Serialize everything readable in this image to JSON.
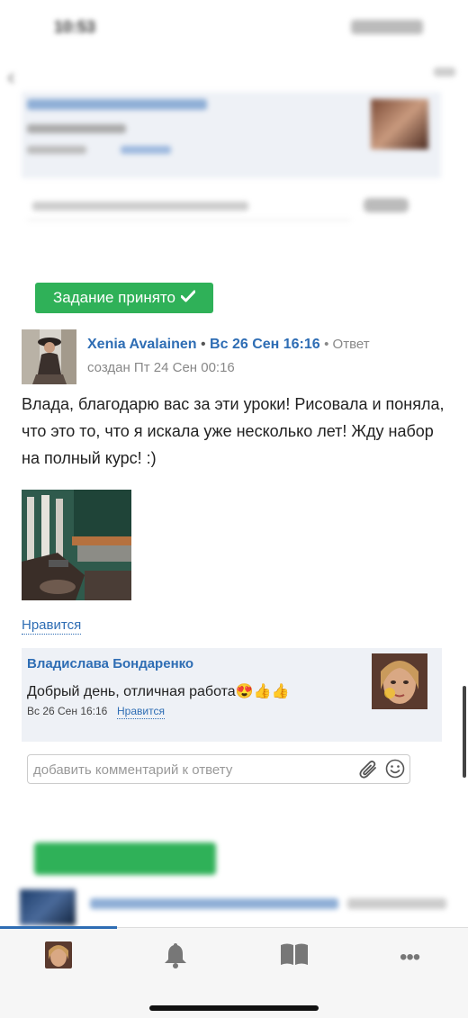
{
  "post": {
    "status_badge": "Задание принято",
    "author": "Xenia Avalainen",
    "bullet": "•",
    "date": "Вс 26 Сен 16:16",
    "meta_suffix": "• Ответ",
    "created_text": "создан Пт 24 Сен 00:16",
    "body": "Влада, благодарю вас за эти уроки! Рисовала и поняла, что это то, что я искала уже несколько лет! Жду набор на полный курс! :)",
    "like_label": "Нравится"
  },
  "comment": {
    "author": "Владислава Бондаренко",
    "text": "Добрый день, отличная работа😍👍👍",
    "date": "Вс 26 Сен 16:16",
    "like_label": "Нравится"
  },
  "comment_input": {
    "placeholder": "добавить комментарий к ответу"
  },
  "tabbar": {
    "items": [
      {
        "icon": "profile-avatar"
      },
      {
        "icon": "bell-icon"
      },
      {
        "icon": "book-icon"
      },
      {
        "icon": "more-icon"
      }
    ]
  },
  "colors": {
    "accent": "#2e6db4",
    "success": "#2fb158"
  }
}
